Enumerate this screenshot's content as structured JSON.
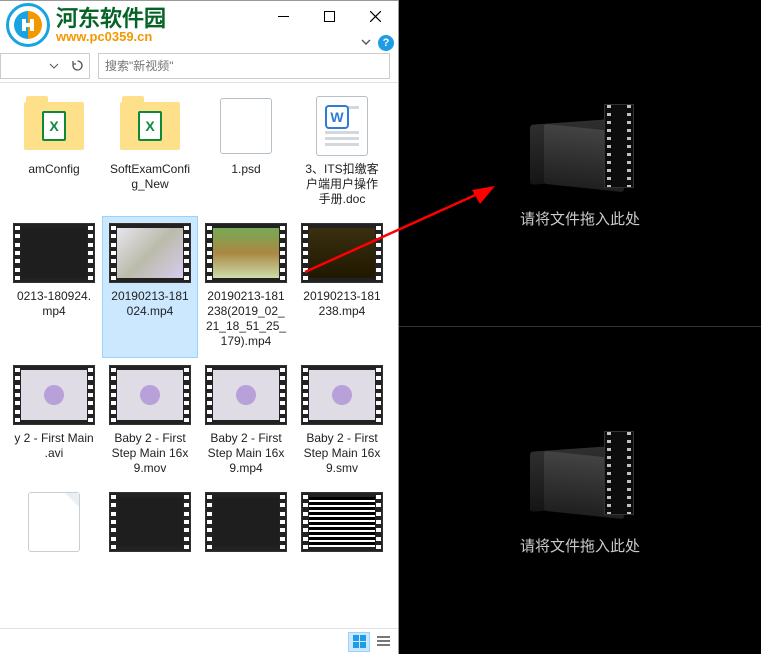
{
  "watermark": {
    "cn": "河东软件园",
    "url": "www.pc0359.cn"
  },
  "window": {
    "minimize": "—",
    "maximize": "▢",
    "close": "✕",
    "help": "?"
  },
  "address": {
    "refresh_icon": "refresh",
    "dropdown_icon": "chevron-down"
  },
  "search": {
    "placeholder": "搜索\"新视频\""
  },
  "files": [
    {
      "label": "amConfig",
      "kind": "folder-xls"
    },
    {
      "label": "SoftExamConfig_New",
      "kind": "folder-xls"
    },
    {
      "label": "1.psd",
      "kind": "psd"
    },
    {
      "label": "3、ITS扣缴客户端用户操作手册.doc",
      "kind": "doc-w"
    },
    {
      "label": "0213-180924.mp4",
      "kind": "film-dark"
    },
    {
      "label": "20190213-181024.mp4",
      "kind": "film-bright",
      "selected": true
    },
    {
      "label": "20190213-181238(2019_02_21_18_51_25_179).mp4",
      "kind": "film-bright-b"
    },
    {
      "label": "20190213-181238.mp4",
      "kind": "film-dark2"
    },
    {
      "label": "y 2 - First Main .avi",
      "kind": "film-c"
    },
    {
      "label": "Baby 2 - First Step Main 16x9.mov",
      "kind": "film-c"
    },
    {
      "label": "Baby 2 - First Step Main 16x9.mp4",
      "kind": "film-c"
    },
    {
      "label": "Baby 2 - First Step Main 16x9.smv",
      "kind": "film-c"
    },
    {
      "label": "",
      "kind": "blank"
    },
    {
      "label": "",
      "kind": "film-dark"
    },
    {
      "label": "",
      "kind": "film-dark"
    },
    {
      "label": "",
      "kind": "film-dark-bars"
    }
  ],
  "drop": {
    "text": "请将文件拖入此处"
  },
  "status": {
    "view_large": "large-icons",
    "view_details": "details"
  }
}
